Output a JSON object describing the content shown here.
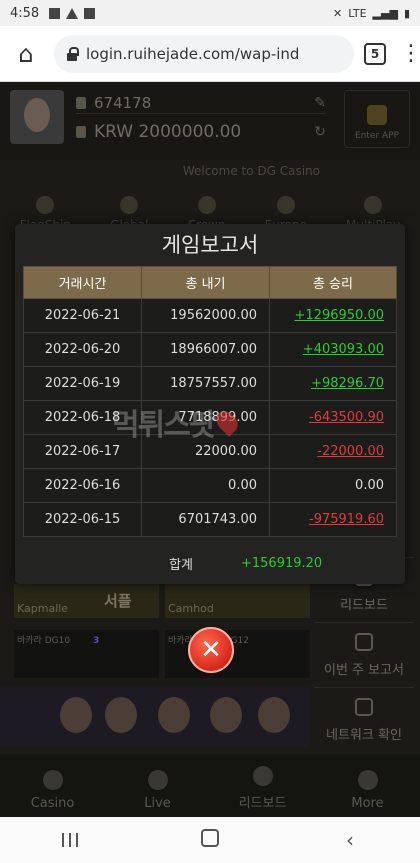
{
  "status_bar": {
    "time": "4:58",
    "network": "LTE"
  },
  "browser": {
    "url": "login.ruihejade.com/wap-ind",
    "tab_count": "5"
  },
  "app": {
    "user_id": "674178",
    "balance": "KRW 2000000.00",
    "enter_app": "Enter APP",
    "welcome": "Welcome to DG Casino",
    "categories": [
      "FlagShip",
      "Global",
      "Crown",
      "Europe",
      "MultiPlay"
    ],
    "lobby_cards": [
      "Kapmalle",
      "서플",
      "Camhod"
    ],
    "game_rows": [
      "바카라 DG10",
      "바카라/바카라 DG12"
    ],
    "game_badge": "3",
    "side_buttons": [
      "리드보드",
      "이번 주 보고서",
      "네트워크 확인"
    ],
    "bottom_nav": [
      "Casino",
      "Live",
      "리드보드",
      "More"
    ]
  },
  "modal": {
    "title": "게임보고서",
    "columns": [
      "거래시간",
      "총 내기",
      "총 승리"
    ],
    "rows": [
      {
        "date": "2022-06-21",
        "bet": "19562000.00",
        "win": "+1296950.00",
        "sign": "pos"
      },
      {
        "date": "2022-06-20",
        "bet": "18966007.00",
        "win": "+403093.00",
        "sign": "pos"
      },
      {
        "date": "2022-06-19",
        "bet": "18757557.00",
        "win": "+98296.70",
        "sign": "pos"
      },
      {
        "date": "2022-06-18",
        "bet": "7718899.00",
        "win": "-643500.90",
        "sign": "neg"
      },
      {
        "date": "2022-06-17",
        "bet": "22000.00",
        "win": "-22000.00",
        "sign": "neg"
      },
      {
        "date": "2022-06-16",
        "bet": "0.00",
        "win": "0.00",
        "sign": "zero"
      },
      {
        "date": "2022-06-15",
        "bet": "6701743.00",
        "win": "-975919.60",
        "sign": "neg"
      }
    ],
    "total_label": "합계",
    "total_value": "+156919.20",
    "close_symbol": "✕"
  },
  "watermark": "먹튀스팟",
  "colors": {
    "positive": "#2ecc2e",
    "negative": "#e23b3b",
    "header": "#7d6a4a",
    "close": "#d9261c"
  }
}
